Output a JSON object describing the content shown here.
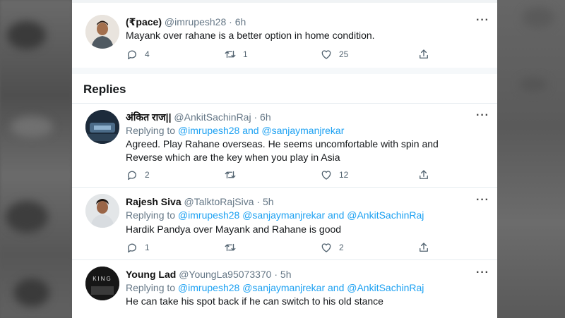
{
  "header_tweet": {
    "name": "(₹pace)",
    "handle": "@imrupesh28",
    "time": "6h",
    "text": "Mayank over rahane is a better option in home condition.",
    "replies": "4",
    "retweets": "1",
    "likes": "25"
  },
  "section_title": "Replies",
  "replies": [
    {
      "name": "अंकित राज||",
      "handle": "@AnkitSachinRaj",
      "time": "6h",
      "replying_prefix": "Replying to",
      "mentions": "@imrupesh28 and @sanjaymanjrekar",
      "text_line1": "Agreed. Play Rahane overseas. He seems uncomfortable with spin and",
      "text_line2": "Reverse which are the key when you play in Asia",
      "replies": "2",
      "retweets": "",
      "likes": "12"
    },
    {
      "name": "Rajesh Siva",
      "handle": "@TalktoRajSiva",
      "time": "5h",
      "replying_prefix": "Replying to",
      "mentions": "@imrupesh28 @sanjaymanjrekar and @AnkitSachinRaj",
      "text_line1": "Hardik Pandya over Mayank and Rahane is good",
      "replies": "1",
      "retweets": "",
      "likes": "2"
    },
    {
      "name": "Young Lad",
      "handle": "@YoungLa95073370",
      "time": "5h",
      "replying_prefix": "Replying to",
      "mentions": "@imrupesh28 @sanjaymanjrekar and @AnkitSachinRaj",
      "text_line1": "He can  take his spot back if he  can switch to his old stance",
      "avatar_text": "KING"
    }
  ],
  "time_separator": "·",
  "icons": {
    "more": "more-icon",
    "reply": "reply-icon",
    "retweet": "retweet-icon",
    "like": "like-icon",
    "share": "share-icon"
  },
  "colors": {
    "link": "#1da1f2",
    "muted": "#657786",
    "text": "#14171a",
    "icon": "#536471"
  }
}
